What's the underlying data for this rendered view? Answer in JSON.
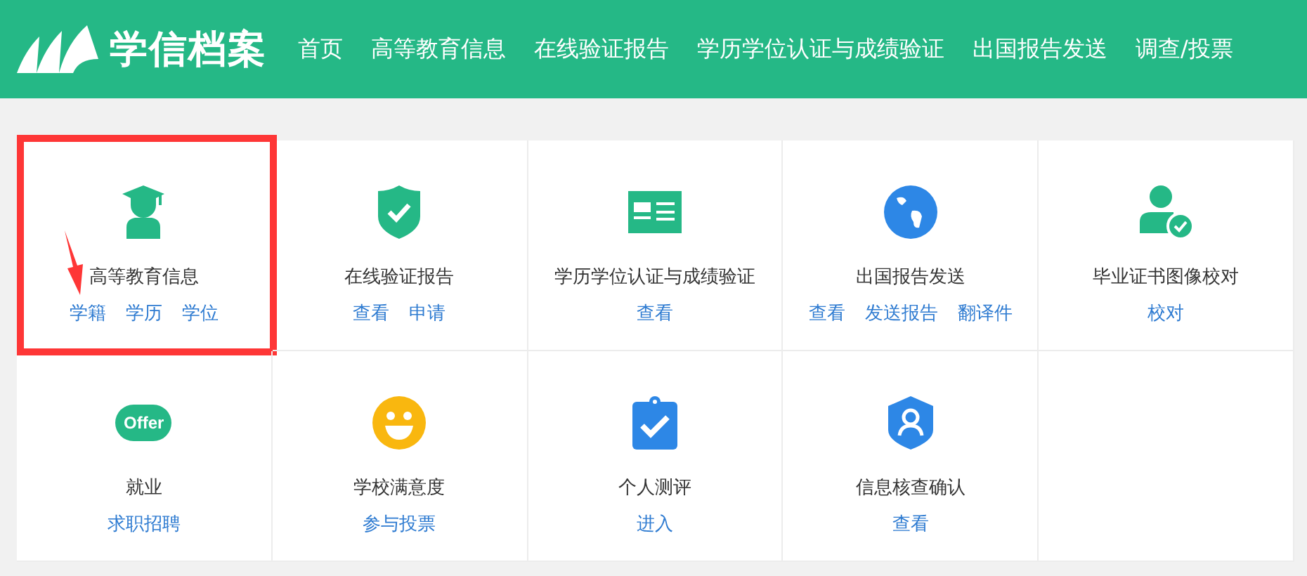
{
  "header": {
    "logo_text": "学信档案",
    "nav": [
      {
        "label": "首页"
      },
      {
        "label": "高等教育信息"
      },
      {
        "label": "在线验证报告"
      },
      {
        "label": "学历学位认证与成绩验证"
      },
      {
        "label": "出国报告发送"
      },
      {
        "label": "调查/投票"
      }
    ]
  },
  "tiles": [
    {
      "title": "高等教育信息",
      "links": [
        "学籍",
        "学历",
        "学位"
      ],
      "highlighted": true
    },
    {
      "title": "在线验证报告",
      "links": [
        "查看",
        "申请"
      ],
      "highlighted": false
    },
    {
      "title": "学历学位认证与成绩验证",
      "links": [
        "查看"
      ],
      "highlighted": false
    },
    {
      "title": "出国报告发送",
      "links": [
        "查看",
        "发送报告",
        "翻译件"
      ],
      "highlighted": false
    },
    {
      "title": "毕业证书图像校对",
      "links": [
        "校对"
      ],
      "highlighted": false
    },
    {
      "icon_text": "Offer",
      "title": "就业",
      "links": [
        "求职招聘"
      ],
      "highlighted": false
    },
    {
      "title": "学校满意度",
      "links": [
        "参与投票"
      ],
      "highlighted": false
    },
    {
      "title": "个人测评",
      "links": [
        "进入"
      ],
      "highlighted": false
    },
    {
      "title": "信息核查确认",
      "links": [
        "查看"
      ],
      "highlighted": false
    }
  ]
}
